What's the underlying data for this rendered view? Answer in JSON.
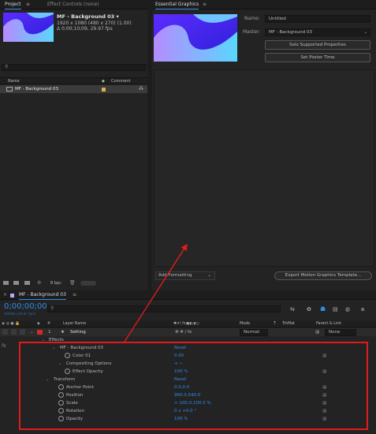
{
  "project": {
    "tabs": [
      {
        "label": "Project"
      },
      {
        "label": "Effect Controls (none)"
      }
    ],
    "item_name": "MF - Background 03 ▾",
    "item_resolution": "1920 x 1080  (480 x 270) (1.00)",
    "item_duration": "Δ 0;00;10;09, 29.97 fps",
    "columns": {
      "name": "Name",
      "comment": "Comment"
    },
    "rows": [
      {
        "name": "MF - Background 03"
      }
    ],
    "bpc": "8 bpc",
    "search_placeholder": ""
  },
  "essential_graphics": {
    "tab": "Essential Graphics",
    "name_label": "Name:",
    "name_value": "Untitled",
    "master_label": "Master:",
    "master_value": "MF - Background 03",
    "solo_button": "Solo Supported Properties",
    "poster_button": "Set Poster Time",
    "add_formatting": "Add Formatting",
    "export_button": "Export Motion Graphics Template..."
  },
  "timeline": {
    "comp_tab": "MF - Background 03",
    "timecode": "0;00;00;00",
    "timecode_sub": "00000 (29.97 fps)",
    "columns": {
      "layer_name": "Layer Name",
      "switches": "✱✦\\ fx▣◐◑○",
      "mode": "Mode",
      "t": "T",
      "trkmat": "TrkMat",
      "parent": "Parent & Link"
    },
    "layer": {
      "num": "1",
      "name": "Setting",
      "mode": "Normal",
      "parent": "None"
    },
    "effects_label": "Effects",
    "props": [
      {
        "label": "MF - Background 03",
        "value": "Reset",
        "indent": 2,
        "twirl": true,
        "stopwatch": false
      },
      {
        "label": "Color 01",
        "value": "0.00",
        "indent": 4,
        "twirl": false,
        "stopwatch": true
      },
      {
        "label": "Compositing Options",
        "value": "+ −",
        "indent": 3,
        "twirl": true,
        "stopwatch": false
      },
      {
        "label": "Effect Opacity",
        "value": "100 %",
        "indent": 4,
        "twirl": false,
        "stopwatch": true
      },
      {
        "label": "Transform",
        "value": "Reset",
        "indent": 1,
        "twirl": true,
        "stopwatch": false
      },
      {
        "label": "Anchor Point",
        "value": "0.0,0.0",
        "indent": 3,
        "twirl": false,
        "stopwatch": true
      },
      {
        "label": "Position",
        "value": "960.0,540.0",
        "indent": 3,
        "twirl": false,
        "stopwatch": true
      },
      {
        "label": "Scale",
        "value": "∞ 100.0,100.0 %",
        "indent": 3,
        "twirl": false,
        "stopwatch": true
      },
      {
        "label": "Rotation",
        "value": "0 x +0.0 °",
        "indent": 3,
        "twirl": false,
        "stopwatch": true
      },
      {
        "label": "Opacity",
        "value": "100 %",
        "indent": 3,
        "twirl": false,
        "stopwatch": true
      }
    ]
  },
  "colors": {
    "accent": "#2d8ceb",
    "annotation": "#e01b1b",
    "label_red": "#d02a2a"
  }
}
